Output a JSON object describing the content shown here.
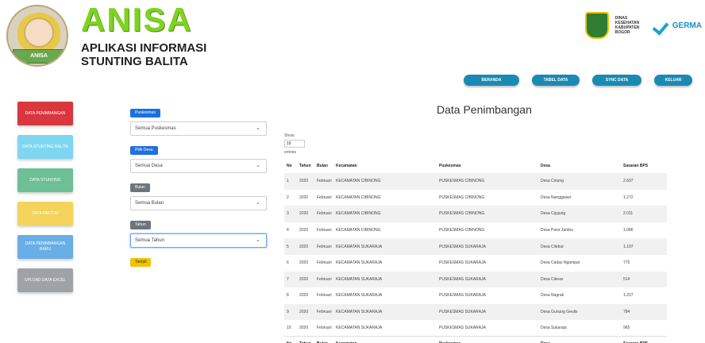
{
  "brand": {
    "name": "ANISA",
    "subtitle_line1": "APLIKASI INFORMASI",
    "subtitle_line2": "STUNTING BALITA",
    "logo_text": "ANISA",
    "seal_text": "DINAS KESEHATAN KABUPATEN BOGOR",
    "partner_text": "GERMA"
  },
  "topnav": [
    {
      "label": "BERANDA",
      "width": 70
    },
    {
      "label": "TABEL DATA",
      "width": 60
    },
    {
      "label": "SYNC DATA",
      "width": 62
    },
    {
      "label": "KELUAR",
      "width": 48
    }
  ],
  "leftmenu": [
    {
      "label": "DATA PENIMBANGAN",
      "color": "#d9363e"
    },
    {
      "label": "DATA STUNTING BALITA",
      "color": "#7fd6f0"
    },
    {
      "label": "DATA STUNTING",
      "color": "#6dbf95"
    },
    {
      "label": "DATA FAKTOR",
      "color": "#f3d35b"
    },
    {
      "label": "DATA PENIMBANGAN BARU",
      "color": "#6aaee8"
    },
    {
      "label": "UPLOAD DATA EXCEL",
      "color": "#9fa3a8"
    }
  ],
  "filters": {
    "chip1": "Puskesmas",
    "select1": "Semua Puskesmas",
    "chip2": "Pilih Desa",
    "select2": "Semua Desa",
    "chip3": "Bulan",
    "select3": "Semua Bulan",
    "chip4": "Tahun",
    "select4": "Semua Tahun",
    "submit": "Tampil"
  },
  "panel": {
    "title": "Data Penimbangan",
    "show_label": "Show",
    "show_value": "10",
    "entries_label": "entries"
  },
  "table": {
    "headers": [
      "No",
      "Tahun",
      "Bulan",
      "Kecamatan",
      "Puskesmas",
      "Desa",
      "Sasaran BPS"
    ],
    "rows": [
      [
        "1",
        "2020",
        "Februari",
        "KECAMATAN CIBINONG",
        "PUSKESMAS CIBINONG",
        "Desa Ciriung",
        "2.697"
      ],
      [
        "2",
        "2020",
        "Februari",
        "KECAMATAN CIBINONG",
        "PUSKESMAS CIBINONG",
        "Desa Nanggewer",
        "1.272"
      ],
      [
        "3",
        "2020",
        "Februari",
        "KECAMATAN CIBINONG",
        "PUSKESMAS CIBINONG",
        "Desa Cijujung",
        "2.011"
      ],
      [
        "4",
        "2020",
        "Februari",
        "KECAMATAN CIBINONG",
        "PUSKESMAS CIBINONG",
        "Desa Pasir Jambu",
        "1.086"
      ],
      [
        "5",
        "2020",
        "Februari",
        "KECAMATAN SUKARAJA",
        "PUSKESMAS SUKARAJA",
        "Desa Cilebut",
        "1.197"
      ],
      [
        "6",
        "2020",
        "Februari",
        "KECAMATAN SUKARAJA",
        "PUSKESMAS SUKARAJA",
        "Desa Cadas Ngampar",
        "775"
      ],
      [
        "7",
        "2020",
        "Februari",
        "KECAMATAN SUKARAJA",
        "PUSKESMAS SUKARAJA",
        "Desa Cikeas",
        "514"
      ],
      [
        "8",
        "2020",
        "Februari",
        "KECAMATAN SUKARAJA",
        "PUSKESMAS SUKARAJA",
        "Desa Nagrak",
        "1.227"
      ],
      [
        "9",
        "2020",
        "Februari",
        "KECAMATAN SUKARAJA",
        "PUSKESMAS SUKARAJA",
        "Desa Gunung Geulis",
        "784"
      ],
      [
        "10",
        "2020",
        "Februari",
        "KECAMATAN SUKARAJA",
        "PUSKESMAS SUKARAJA",
        "Desa Sukaraja",
        "965"
      ]
    ]
  }
}
